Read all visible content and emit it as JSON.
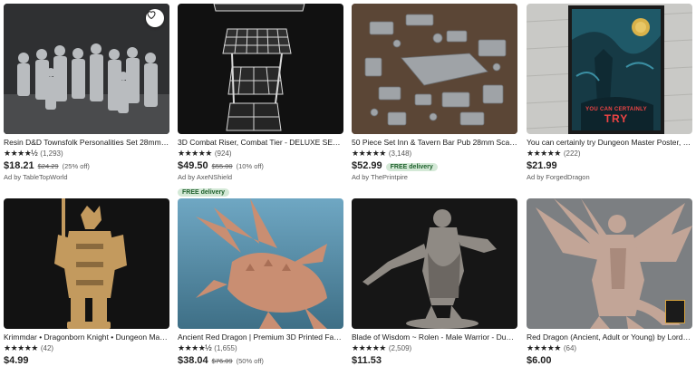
{
  "products": [
    {
      "title": "Resin D&D Townsfolk Personalities Set 28mm S…",
      "stars": "★★★★½",
      "reviews": "(1,293)",
      "price": "$18.21",
      "orig": "$24.29",
      "disc": "(25% off)",
      "free_delivery": "",
      "ad": "Ad by TableTopWorld"
    },
    {
      "title": "3D Combat Riser, Combat Tier - DELUXE SET - (…",
      "stars": "★★★★★",
      "reviews": "(924)",
      "price": "$49.50",
      "orig": "$55.00",
      "disc": "(10% off)",
      "free_delivery": "FREE delivery",
      "ad": "Ad by AxeNShield"
    },
    {
      "title": "50 Piece Set Inn & Tavern Bar Pub 28mm Scatt…",
      "stars": "★★★★★",
      "reviews": "(3,148)",
      "price": "$52.99",
      "orig": "",
      "disc": "",
      "free_delivery": "FREE delivery",
      "ad": "Ad by ThePrintpire"
    },
    {
      "title": "You can certainly try Dungeon Master Poster, D…",
      "stars": "★★★★★",
      "reviews": "(222)",
      "price": "$21.99",
      "orig": "",
      "disc": "",
      "free_delivery": "",
      "ad": "Ad by ForgedDragon"
    },
    {
      "title": "Krimmdar • Dragonborn Knight • Dungeon Mas…",
      "stars": "★★★★★",
      "reviews": "(42)",
      "price": "$4.99",
      "orig": "",
      "disc": "",
      "free_delivery": "",
      "ad": ""
    },
    {
      "title": "Ancient Red Dragon | Premium 3D Printed Fant…",
      "stars": "★★★★½",
      "reviews": "(1,655)",
      "price": "$38.04",
      "orig": "$76.09",
      "disc": "(50% off)",
      "free_delivery": "",
      "ad": ""
    },
    {
      "title": "Blade of Wisdom ~ Rolen - Male Warrior - Dung…",
      "stars": "★★★★★",
      "reviews": "(2,509)",
      "price": "$11.53",
      "orig": "",
      "disc": "",
      "free_delivery": "",
      "ad": ""
    },
    {
      "title": "Red Dragon (Ancient, Adult or Young) by Lord …",
      "stars": "★★★★★",
      "reviews": "(64)",
      "price": "$6.00",
      "orig": "",
      "disc": "",
      "free_delivery": "",
      "ad": ""
    }
  ],
  "poster_text": {
    "line1": "YOU CAN CERTAINLY",
    "line2": "TRY"
  },
  "icons": {
    "favorite": "heart-outline-icon"
  },
  "colors": {
    "free_delivery_bg": "#d4e9d7",
    "free_delivery_text": "#1d5f2b"
  }
}
